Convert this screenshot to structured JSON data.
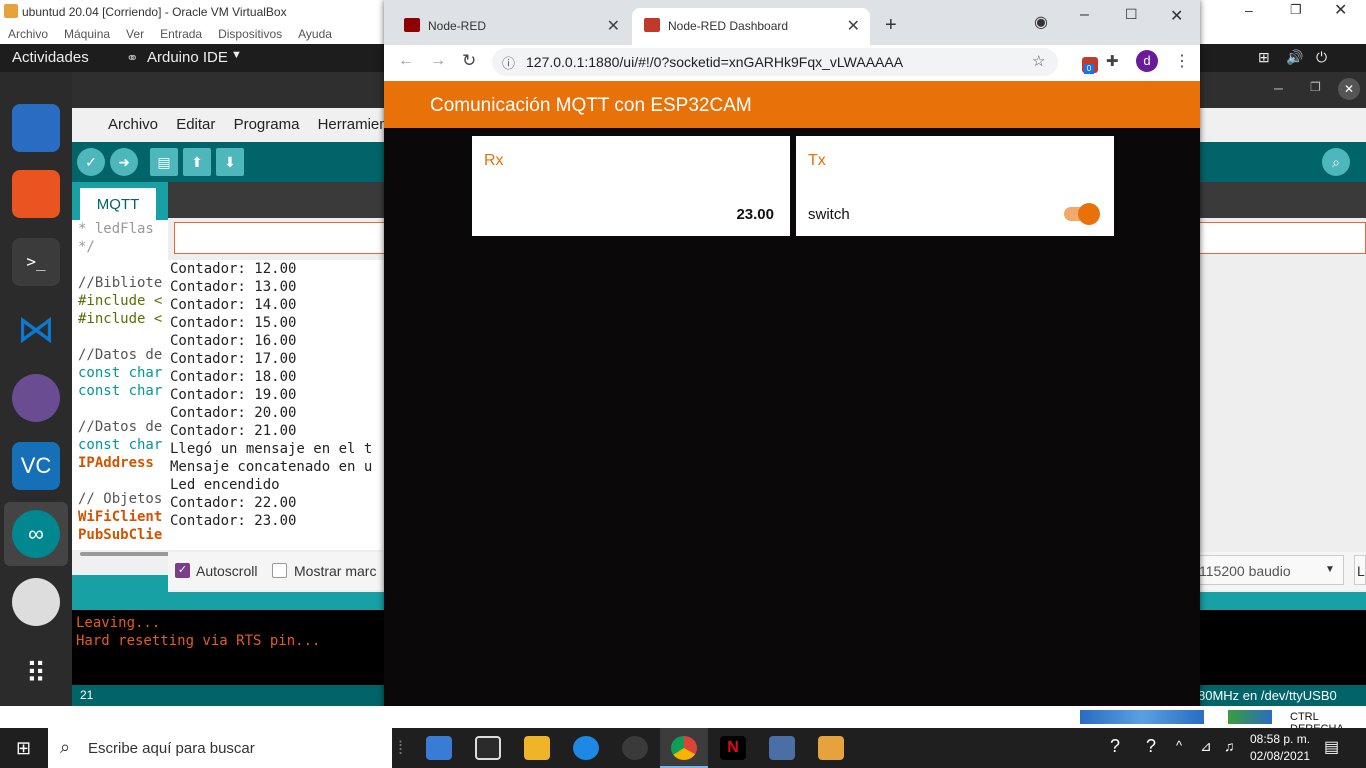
{
  "vbox": {
    "title": "ubuntud 20.04 [Corriendo] - Oracle VM VirtualBox",
    "menu": [
      "Archivo",
      "Máquina",
      "Ver",
      "Entrada",
      "Dispositivos",
      "Ayuda"
    ],
    "status_right": "CTRL DERECHA"
  },
  "ubuntu": {
    "activities": "Actividades",
    "app": "Arduino IDE"
  },
  "arduino": {
    "menu": [
      "Archivo",
      "Editar",
      "Programa",
      "Herramientas"
    ],
    "tab": "MQTT",
    "code_lines": [
      " * ledFlas",
      " */",
      "",
      "//Bibliote",
      "#include <",
      "#include <",
      "",
      "//Datos de",
      "const char",
      "const char",
      "",
      "//Datos de",
      "const char",
      "IPAddress",
      "",
      "// Objetos",
      "WiFiClient",
      "PubSubClie"
    ],
    "console": [
      "Leaving...",
      "Hard resetting via RTS pin..."
    ],
    "status_line": "21",
    "status_port": "80MHz en /dev/ttyUSB0"
  },
  "serial": {
    "lines": [
      "Contador: 12.00",
      "Contador: 13.00",
      "Contador: 14.00",
      "Contador: 15.00",
      "Contador: 16.00",
      "Contador: 17.00",
      "Contador: 18.00",
      "Contador: 19.00",
      "Contador: 20.00",
      "Contador: 21.00",
      "Llegó un mensaje en el t",
      "Mensaje concatenado en u",
      "Led encendido",
      "Contador: 22.00",
      "Contador: 23.00"
    ],
    "autoscroll_label": "Autoscroll",
    "timestamp_label": "Mostrar marc",
    "baud": "115200 baudio",
    "extra": "L"
  },
  "chrome": {
    "tab1": "Node-RED",
    "tab2": "Node-RED Dashboard",
    "url": "127.0.0.1:1880/ui/#!/0?socketid=xnGARHk9Fqx_vLWAAAAA",
    "ext_badge": "0",
    "profile": "d"
  },
  "dashboard": {
    "title": "Comunicación MQTT con ESP32CAM",
    "rx_title": "Rx",
    "rx_value": "23.00",
    "tx_title": "Tx",
    "tx_label": "switch",
    "switch_on": true,
    "accent": "#e8710a"
  },
  "taskbar": {
    "search": "Escribe aquí para buscar",
    "time": "08:58 p. m.",
    "date": "02/08/2021"
  }
}
